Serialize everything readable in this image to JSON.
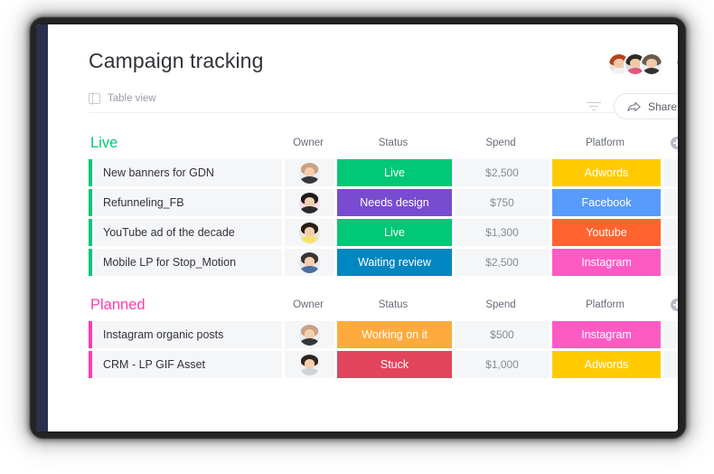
{
  "header": {
    "title": "Campaign tracking",
    "share_label": "Share",
    "share_icon": "share-icon",
    "filter_icon": "filter-icon",
    "more_icon": "more-options-icon",
    "avatars": [
      {
        "name": "avatar-1",
        "hair": "#b4421c",
        "body": "#f0f1f3",
        "bg": "#e8e2dc"
      },
      {
        "name": "avatar-2",
        "hair": "#2f2a28",
        "body": "#e8547a",
        "bg": "#dcdcdc"
      },
      {
        "name": "avatar-3",
        "hair": "#6a5a4a",
        "body": "#2f3136",
        "bg": "#eceff1"
      }
    ]
  },
  "viewbar": {
    "label": "Table view",
    "icon": "table-view-icon"
  },
  "columns": [
    "Owner",
    "Status",
    "Spend",
    "Platform"
  ],
  "add_column_icon": "add-column-icon",
  "groups": [
    {
      "title": "Live",
      "color": "#00c875",
      "rows": [
        {
          "name": "New banners for GDN",
          "owner": {
            "name": "owner-avatar",
            "hair": "#c9a183",
            "body": "#35373d",
            "bg": "#eceef1"
          },
          "status": {
            "label": "Live",
            "color": "#00c875"
          },
          "spend": "$2,500",
          "platform": {
            "label": "Adwords",
            "color": "#ffcb00"
          }
        },
        {
          "name": "Refunneling_FB",
          "owner": {
            "name": "owner-avatar",
            "hair": "#1d1a1a",
            "body": "#2b2b30",
            "bg": "#fbd9e6"
          },
          "status": {
            "label": "Needs design",
            "color": "#784bd1"
          },
          "spend": "$750",
          "platform": {
            "label": "Facebook",
            "color": "#579bfc"
          }
        },
        {
          "name": "YouTube ad of the decade",
          "owner": {
            "name": "owner-avatar",
            "hair": "#2a1d14",
            "body": "#f2e36b",
            "bg": "#e9e6df"
          },
          "status": {
            "label": "Live",
            "color": "#00c875"
          },
          "spend": "$1,300",
          "platform": {
            "label": "Youtube",
            "color": "#ff642e"
          }
        },
        {
          "name": "Mobile LP for Stop_Motion",
          "owner": {
            "name": "owner-avatar",
            "hair": "#3a3330",
            "body": "#4a6fa1",
            "bg": "#e4e6e9"
          },
          "status": {
            "label": "Waiting review",
            "color": "#0086c0"
          },
          "spend": "$2,500",
          "platform": {
            "label": "Instagram",
            "color": "#ff5ac4"
          }
        }
      ]
    },
    {
      "title": "Planned",
      "color": "#ff3bae",
      "rows": [
        {
          "name": "Instagram organic posts",
          "owner": {
            "name": "owner-avatar",
            "hair": "#c9a183",
            "body": "#35373d",
            "bg": "#eceef1"
          },
          "status": {
            "label": "Working on it",
            "color": "#fdab3d"
          },
          "spend": "$500",
          "platform": {
            "label": "Instagram",
            "color": "#ff5ac4"
          }
        },
        {
          "name": "CRM - LP GIF Asset",
          "owner": {
            "name": "owner-avatar",
            "hair": "#2e2521",
            "body": "#cfd3d8",
            "bg": "#f0f0f0"
          },
          "status": {
            "label": "Stuck",
            "color": "#e2445c"
          },
          "spend": "$1,000",
          "platform": {
            "label": "Adwords",
            "color": "#ffcb00"
          }
        }
      ]
    }
  ]
}
